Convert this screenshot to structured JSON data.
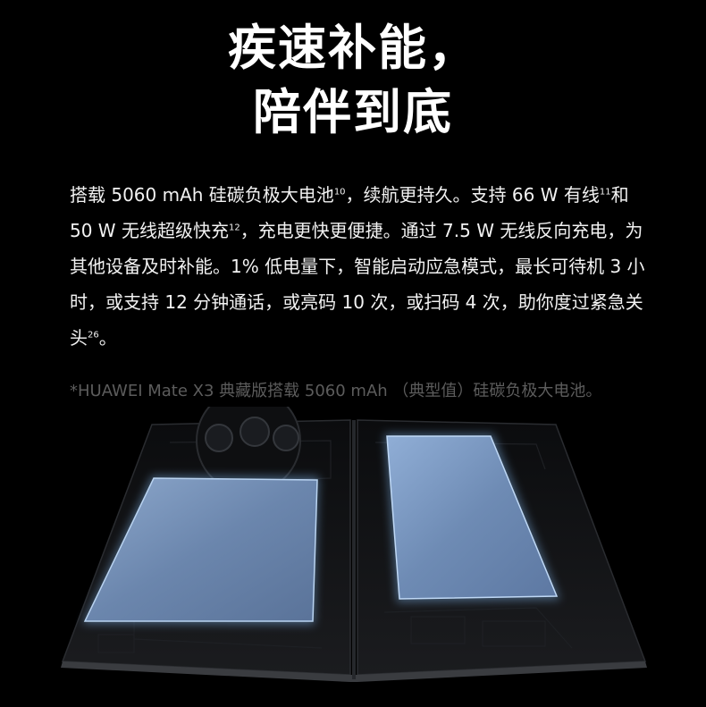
{
  "headline": {
    "line1": "疾速补能，",
    "line2": "陪伴到底"
  },
  "description": {
    "part1": "搭载 5060 mAh 硅碳负极大电池",
    "sup1": "10",
    "part2": "，续航更持久。支持 66 W 有线",
    "sup2": "11",
    "part3": "和 50 W 无线超级快充",
    "sup3": "12",
    "part4": "，充电更快更便捷。通过 7.5 W 无线反向充电，为其他设备及时补能。1% 低电量下，智能启动应急模式，最长可待机 3 小时，或支持 12 分钟通话，或亮码 10 次，或扫码 4 次，助你度过紧急关头",
    "sup4": "26",
    "part5": "。"
  },
  "footnote": "*HUAWEI Mate X3 典藏版搭载 5060 mAh （典型值）硅碳负极大电池。",
  "colors": {
    "background": "#000000",
    "battery": "#6f8fb8",
    "glow": "#9fd0ff"
  }
}
